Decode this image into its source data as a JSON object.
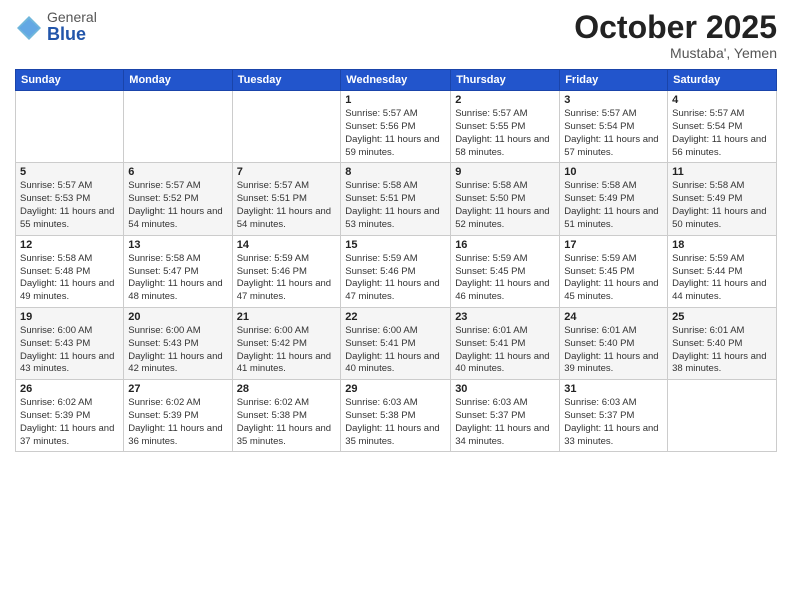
{
  "header": {
    "logo_general": "General",
    "logo_blue": "Blue",
    "month": "October 2025",
    "location": "Mustaba', Yemen"
  },
  "days_of_week": [
    "Sunday",
    "Monday",
    "Tuesday",
    "Wednesday",
    "Thursday",
    "Friday",
    "Saturday"
  ],
  "weeks": [
    [
      {
        "num": "",
        "info": ""
      },
      {
        "num": "",
        "info": ""
      },
      {
        "num": "",
        "info": ""
      },
      {
        "num": "1",
        "info": "Sunrise: 5:57 AM\nSunset: 5:56 PM\nDaylight: 11 hours and 59 minutes."
      },
      {
        "num": "2",
        "info": "Sunrise: 5:57 AM\nSunset: 5:55 PM\nDaylight: 11 hours and 58 minutes."
      },
      {
        "num": "3",
        "info": "Sunrise: 5:57 AM\nSunset: 5:54 PM\nDaylight: 11 hours and 57 minutes."
      },
      {
        "num": "4",
        "info": "Sunrise: 5:57 AM\nSunset: 5:54 PM\nDaylight: 11 hours and 56 minutes."
      }
    ],
    [
      {
        "num": "5",
        "info": "Sunrise: 5:57 AM\nSunset: 5:53 PM\nDaylight: 11 hours and 55 minutes."
      },
      {
        "num": "6",
        "info": "Sunrise: 5:57 AM\nSunset: 5:52 PM\nDaylight: 11 hours and 54 minutes."
      },
      {
        "num": "7",
        "info": "Sunrise: 5:57 AM\nSunset: 5:51 PM\nDaylight: 11 hours and 54 minutes."
      },
      {
        "num": "8",
        "info": "Sunrise: 5:58 AM\nSunset: 5:51 PM\nDaylight: 11 hours and 53 minutes."
      },
      {
        "num": "9",
        "info": "Sunrise: 5:58 AM\nSunset: 5:50 PM\nDaylight: 11 hours and 52 minutes."
      },
      {
        "num": "10",
        "info": "Sunrise: 5:58 AM\nSunset: 5:49 PM\nDaylight: 11 hours and 51 minutes."
      },
      {
        "num": "11",
        "info": "Sunrise: 5:58 AM\nSunset: 5:49 PM\nDaylight: 11 hours and 50 minutes."
      }
    ],
    [
      {
        "num": "12",
        "info": "Sunrise: 5:58 AM\nSunset: 5:48 PM\nDaylight: 11 hours and 49 minutes."
      },
      {
        "num": "13",
        "info": "Sunrise: 5:58 AM\nSunset: 5:47 PM\nDaylight: 11 hours and 48 minutes."
      },
      {
        "num": "14",
        "info": "Sunrise: 5:59 AM\nSunset: 5:46 PM\nDaylight: 11 hours and 47 minutes."
      },
      {
        "num": "15",
        "info": "Sunrise: 5:59 AM\nSunset: 5:46 PM\nDaylight: 11 hours and 47 minutes."
      },
      {
        "num": "16",
        "info": "Sunrise: 5:59 AM\nSunset: 5:45 PM\nDaylight: 11 hours and 46 minutes."
      },
      {
        "num": "17",
        "info": "Sunrise: 5:59 AM\nSunset: 5:45 PM\nDaylight: 11 hours and 45 minutes."
      },
      {
        "num": "18",
        "info": "Sunrise: 5:59 AM\nSunset: 5:44 PM\nDaylight: 11 hours and 44 minutes."
      }
    ],
    [
      {
        "num": "19",
        "info": "Sunrise: 6:00 AM\nSunset: 5:43 PM\nDaylight: 11 hours and 43 minutes."
      },
      {
        "num": "20",
        "info": "Sunrise: 6:00 AM\nSunset: 5:43 PM\nDaylight: 11 hours and 42 minutes."
      },
      {
        "num": "21",
        "info": "Sunrise: 6:00 AM\nSunset: 5:42 PM\nDaylight: 11 hours and 41 minutes."
      },
      {
        "num": "22",
        "info": "Sunrise: 6:00 AM\nSunset: 5:41 PM\nDaylight: 11 hours and 40 minutes."
      },
      {
        "num": "23",
        "info": "Sunrise: 6:01 AM\nSunset: 5:41 PM\nDaylight: 11 hours and 40 minutes."
      },
      {
        "num": "24",
        "info": "Sunrise: 6:01 AM\nSunset: 5:40 PM\nDaylight: 11 hours and 39 minutes."
      },
      {
        "num": "25",
        "info": "Sunrise: 6:01 AM\nSunset: 5:40 PM\nDaylight: 11 hours and 38 minutes."
      }
    ],
    [
      {
        "num": "26",
        "info": "Sunrise: 6:02 AM\nSunset: 5:39 PM\nDaylight: 11 hours and 37 minutes."
      },
      {
        "num": "27",
        "info": "Sunrise: 6:02 AM\nSunset: 5:39 PM\nDaylight: 11 hours and 36 minutes."
      },
      {
        "num": "28",
        "info": "Sunrise: 6:02 AM\nSunset: 5:38 PM\nDaylight: 11 hours and 35 minutes."
      },
      {
        "num": "29",
        "info": "Sunrise: 6:03 AM\nSunset: 5:38 PM\nDaylight: 11 hours and 35 minutes."
      },
      {
        "num": "30",
        "info": "Sunrise: 6:03 AM\nSunset: 5:37 PM\nDaylight: 11 hours and 34 minutes."
      },
      {
        "num": "31",
        "info": "Sunrise: 6:03 AM\nSunset: 5:37 PM\nDaylight: 11 hours and 33 minutes."
      },
      {
        "num": "",
        "info": ""
      }
    ]
  ]
}
